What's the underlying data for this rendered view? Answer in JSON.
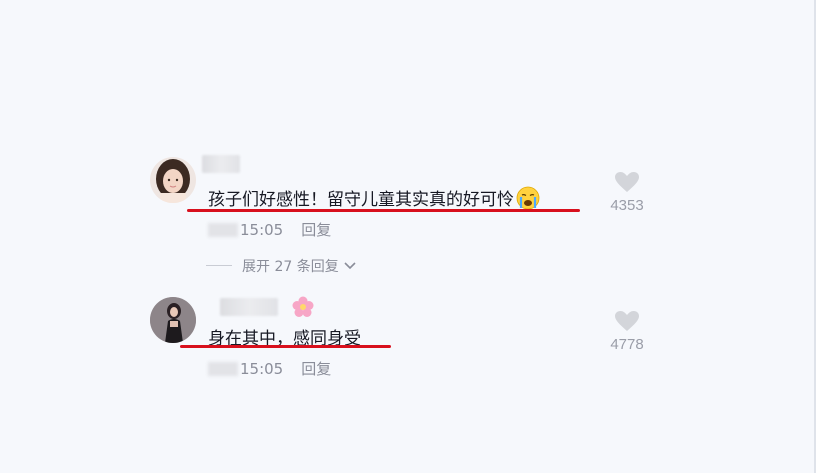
{
  "comments": [
    {
      "text": "孩子们好感性！留守儿童其实真的好可怜",
      "emoji": "crying-face",
      "time": "15:05",
      "reply_label": "回复",
      "likes": "4353",
      "expand_label": "展开 27 条回复"
    },
    {
      "text": "身在其中，感同身受",
      "badge_emoji": "pink-flower",
      "time": "15:05",
      "reply_label": "回复",
      "likes": "4778"
    }
  ],
  "colors": {
    "background": "#f6f8fc",
    "highlight_underline": "#d8101d",
    "text": "#161823",
    "meta_text": "#8a8d99"
  }
}
